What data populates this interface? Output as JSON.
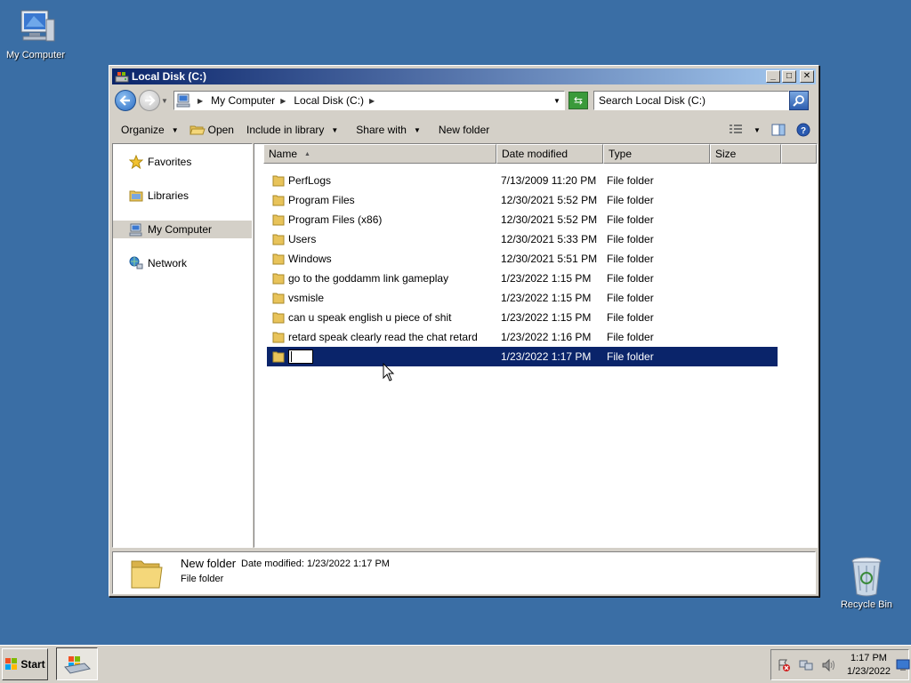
{
  "desktop": {
    "icons": [
      {
        "label": "My Computer",
        "icon": "computer-icon"
      },
      {
        "label": "Recycle Bin",
        "icon": "recycle-bin-icon"
      }
    ]
  },
  "window": {
    "title": "Local Disk (C:)",
    "buttons": {
      "minimize": "_",
      "maximize": "□",
      "close": "✕"
    }
  },
  "address": {
    "crumbs": [
      "My Computer",
      "Local Disk (C:)"
    ],
    "search_placeholder": "Search Local Disk (C:)"
  },
  "toolbar": {
    "organize": "Organize",
    "open": "Open",
    "include_in_library": "Include in library",
    "share_with": "Share with",
    "new_folder": "New folder"
  },
  "nav_pane": {
    "items": [
      {
        "label": "Favorites",
        "icon": "star-icon"
      },
      {
        "label": "Libraries",
        "icon": "library-icon"
      },
      {
        "label": "My Computer",
        "icon": "computer-icon",
        "selected": true
      },
      {
        "label": "Network",
        "icon": "network-icon"
      }
    ]
  },
  "columns": {
    "name": "Name",
    "date": "Date modified",
    "type": "Type",
    "size": "Size"
  },
  "files": [
    {
      "name": "PerfLogs",
      "date": "7/13/2009 11:20 PM",
      "type": "File folder"
    },
    {
      "name": "Program Files",
      "date": "12/30/2021 5:52 PM",
      "type": "File folder"
    },
    {
      "name": "Program Files (x86)",
      "date": "12/30/2021 5:52 PM",
      "type": "File folder"
    },
    {
      "name": "Users",
      "date": "12/30/2021 5:33 PM",
      "type": "File folder"
    },
    {
      "name": "Windows",
      "date": "12/30/2021 5:51 PM",
      "type": "File folder"
    },
    {
      "name": "go to the goddamm link gameplay",
      "date": "1/23/2022 1:15 PM",
      "type": "File folder"
    },
    {
      "name": "vsmisle",
      "date": "1/23/2022 1:15 PM",
      "type": "File folder"
    },
    {
      "name": "can u speak english u piece of shit",
      "date": "1/23/2022 1:15 PM",
      "type": "File folder"
    },
    {
      "name": "retard speak clearly read the chat retard",
      "date": "1/23/2022 1:16 PM",
      "type": "File folder"
    }
  ],
  "renaming_row": {
    "value": "",
    "date": "1/23/2022 1:17 PM",
    "type": "File folder"
  },
  "details": {
    "name": "New folder",
    "meta_label": "Date modified:",
    "meta_value": "1/23/2022 1:17 PM",
    "type": "File folder"
  },
  "taskbar": {
    "start_label": "Start",
    "clock_time": "1:17 PM",
    "clock_date": "1/23/2022"
  }
}
